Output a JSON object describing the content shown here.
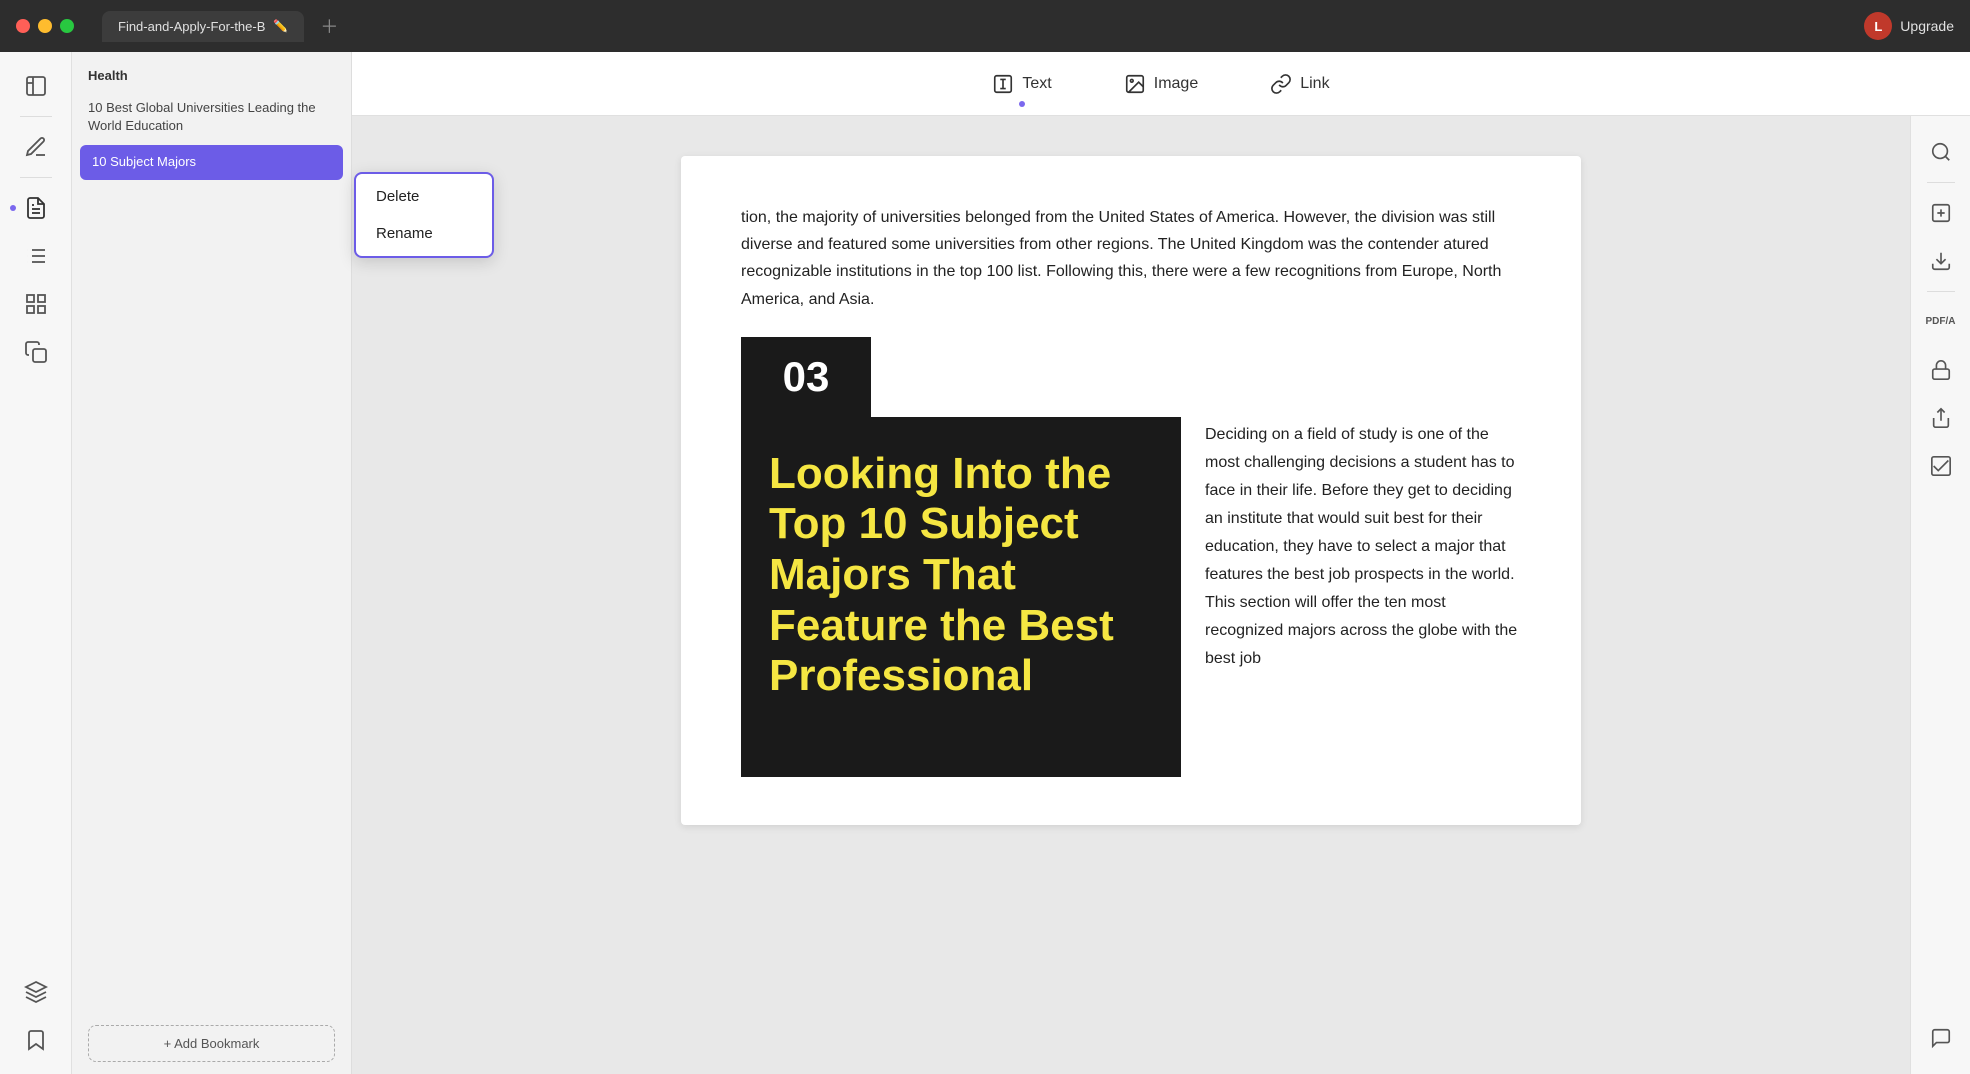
{
  "titlebar": {
    "tab_title": "Find-and-Apply-For-the-B",
    "upgrade_label": "Upgrade",
    "upgrade_initial": "L"
  },
  "toolbar": {
    "text_label": "Text",
    "image_label": "Image",
    "link_label": "Link"
  },
  "outline": {
    "header": "Health",
    "items": [
      {
        "label": "10 Best Global Universities\nLeading the World Education",
        "active": false
      },
      {
        "label": "10 Subject Majors",
        "active": true
      }
    ],
    "add_bookmark": "+ Add Bookmark"
  },
  "context_menu": {
    "items": [
      "Delete",
      "Rename"
    ]
  },
  "document": {
    "paragraph1": "tion, the majority of universities belonged from the United States of America. However, the division was still diverse and featured some universities from other regions. The United Kingdom was the contender atured recognizable institutions in the top 100 list. Following this, there were a few recognitions from Europe, North America, and Asia.",
    "section_number": "03",
    "cover_text": "Looking Into the Top 10 Subject Majors That Feature the Best Professional",
    "description": "Deciding on a field of study is one of the most challenging decisions a student has to face in their life. Before they get to deciding an institute that would suit best for their education, they have to select a major that features the best job prospects in the world. This section will offer the ten most recognized majors across the globe with the best job"
  },
  "right_sidebar": {
    "icons": [
      "search",
      "ocr",
      "save",
      "pdfa",
      "lock",
      "share",
      "check",
      "chat"
    ]
  }
}
